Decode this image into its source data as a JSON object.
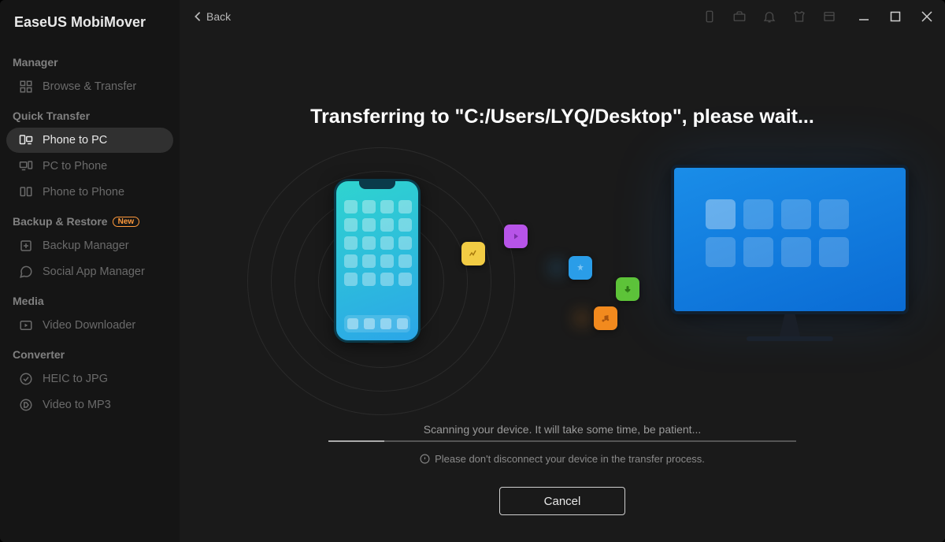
{
  "app": {
    "title": "EaseUS MobiMover"
  },
  "titlebar": {
    "back_label": "Back"
  },
  "sidebar": {
    "sections": [
      {
        "title": "Manager",
        "items": [
          {
            "label": "Browse & Transfer"
          }
        ]
      },
      {
        "title": "Quick Transfer",
        "items": [
          {
            "label": "Phone to PC"
          },
          {
            "label": "PC to Phone"
          },
          {
            "label": "Phone to Phone"
          }
        ]
      },
      {
        "title": "Backup & Restore",
        "badge": "New",
        "items": [
          {
            "label": "Backup Manager"
          },
          {
            "label": "Social App Manager"
          }
        ]
      },
      {
        "title": "Media",
        "items": [
          {
            "label": "Video Downloader"
          }
        ]
      },
      {
        "title": "Converter",
        "items": [
          {
            "label": "HEIC to JPG"
          },
          {
            "label": "Video to MP3"
          }
        ]
      }
    ]
  },
  "main": {
    "heading": "Transferring to \"C:/Users/LYQ/Desktop\", please wait...",
    "scan_text": "Scanning your device. It will take some time, be patient...",
    "warning_text": "Please don't disconnect your device in the transfer process.",
    "cancel_label": "Cancel"
  }
}
